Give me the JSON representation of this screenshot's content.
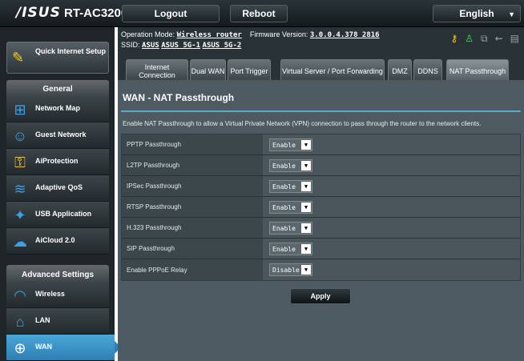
{
  "header": {
    "brand": "/ISUS",
    "model": "RT-AC3200",
    "logout_label": "Logout",
    "reboot_label": "Reboot",
    "language": "English"
  },
  "status": {
    "op_mode_label": "Operation Mode:",
    "op_mode_value": "Wireless router",
    "firmware_label": "Firmware Version:",
    "firmware_value": "3.0.0.4.378_2816",
    "ssid_label": "SSID:",
    "ssids": [
      "ASUS",
      "ASUS_5G-1",
      "ASUS_5G-2"
    ]
  },
  "sidebar": {
    "quick_setup": "Quick Internet Setup",
    "general_header": "General",
    "general_items": [
      {
        "label": "Network Map",
        "icon": "network-map-icon"
      },
      {
        "label": "Guest Network",
        "icon": "guest-network-icon"
      },
      {
        "label": "AiProtection",
        "icon": "lock-icon"
      },
      {
        "label": "Adaptive QoS",
        "icon": "qos-icon"
      },
      {
        "label": "USB Application",
        "icon": "puzzle-icon"
      },
      {
        "label": "AiCloud 2.0",
        "icon": "cloud-icon"
      }
    ],
    "advanced_header": "Advanced Settings",
    "advanced_items": [
      {
        "label": "Wireless",
        "icon": "wireless-icon"
      },
      {
        "label": "LAN",
        "icon": "home-icon"
      },
      {
        "label": "WAN",
        "icon": "globe-icon",
        "active": true
      }
    ]
  },
  "tabs": [
    {
      "label": "Internet Connection"
    },
    {
      "label": "Dual WAN"
    },
    {
      "label": "Port Trigger"
    },
    {
      "label": "Virtual Server / Port Forwarding"
    },
    {
      "label": "DMZ"
    },
    {
      "label": "DDNS"
    },
    {
      "label": "NAT Passthrough",
      "active": true
    }
  ],
  "main": {
    "title": "WAN - NAT Passthrough",
    "description": "Enable NAT Passthrough to allow a Virtual Private Network (VPN) connection to pass through the router to the network clients.",
    "rows": [
      {
        "label": "PPTP Passthrough",
        "value": "Enable"
      },
      {
        "label": "L2TP Passthrough",
        "value": "Enable"
      },
      {
        "label": "IPSec Passthrough",
        "value": "Enable"
      },
      {
        "label": "RTSP Passthrough",
        "value": "Enable"
      },
      {
        "label": "H.323 Passthrough",
        "value": "Enable"
      },
      {
        "label": "SIP Passthrough",
        "value": "Enable"
      },
      {
        "label": "Enable PPPoE Relay",
        "value": "Disable"
      }
    ],
    "apply_label": "Apply"
  }
}
